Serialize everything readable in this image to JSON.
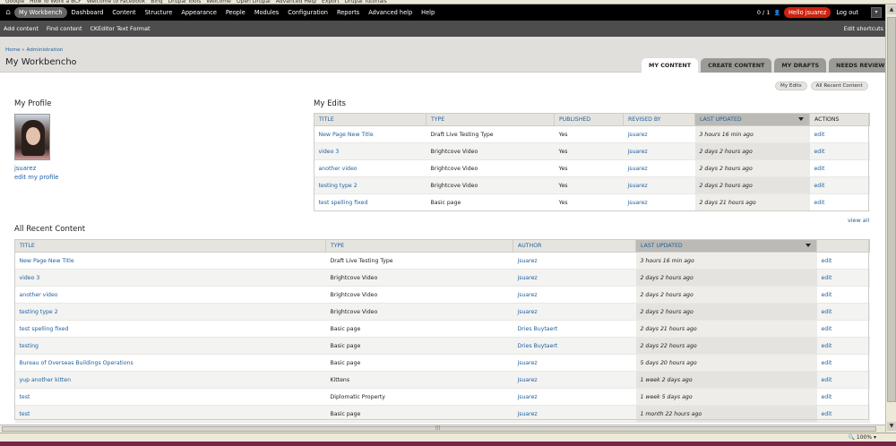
{
  "bookmarks": [
    "Google",
    "How To Work a BCF",
    "Welcome to Facebook",
    "Bing",
    "Drupal Tools",
    "Welcome",
    "Open Drupal",
    "Advanced Help",
    "Export",
    "Drupal Tutorials"
  ],
  "toolbar": {
    "items": [
      "My Workbench",
      "Dashboard",
      "Content",
      "Structure",
      "Appearance",
      "People",
      "Modules",
      "Configuration",
      "Reports",
      "Advanced help",
      "Help"
    ],
    "active_index": 0,
    "count": "0 / 1",
    "hello": "Hello jsuarez",
    "logout": "Log out"
  },
  "shortcuts": {
    "items": [
      "Add content",
      "Find content",
      "CKEditor Text Format"
    ],
    "edit": "Edit shortcuts"
  },
  "header": {
    "breadcrumb": "Home » Administration",
    "title": "My Workbench"
  },
  "tabs": [
    "My Content",
    "Create Content",
    "My Drafts",
    "Needs Review"
  ],
  "tabs_active": 0,
  "subbuttons": [
    "My Edits",
    "All Recent Content"
  ],
  "profile": {
    "heading": "My Profile",
    "username": "jsuarez",
    "edit_link": "edit my profile"
  },
  "my_edits": {
    "heading": "My Edits",
    "columns": [
      "Title",
      "Type",
      "Published",
      "Revised by",
      "Last updated",
      "Actions"
    ],
    "rows": [
      [
        "New Page New Title",
        "Draft Live Testing Type",
        "Yes",
        "jsuarez",
        "3 hours 16 min ago",
        "edit"
      ],
      [
        "video 3",
        "Brightcove Video",
        "Yes",
        "jsuarez",
        "2 days 2 hours ago",
        "edit"
      ],
      [
        "another video",
        "Brightcove Video",
        "Yes",
        "jsuarez",
        "2 days 2 hours ago",
        "edit"
      ],
      [
        "testing type 2",
        "Brightcove Video",
        "Yes",
        "jsuarez",
        "2 days 2 hours ago",
        "edit"
      ],
      [
        "test spelling fixed",
        "Basic page",
        "Yes",
        "jsuarez",
        "2 days 21 hours ago",
        "edit"
      ]
    ],
    "view_all": "view all"
  },
  "recent": {
    "heading": "All Recent Content",
    "columns": [
      "Title",
      "Type",
      "Author",
      "Last updated",
      ""
    ],
    "rows": [
      [
        "New Page New Title",
        "Draft Live Testing Type",
        "jsuarez",
        "3 hours 16 min ago",
        "edit"
      ],
      [
        "video 3",
        "Brightcove Video",
        "jsuarez",
        "2 days 2 hours ago",
        "edit"
      ],
      [
        "another video",
        "Brightcove Video",
        "jsuarez",
        "2 days 2 hours ago",
        "edit"
      ],
      [
        "testing type 2",
        "Brightcove Video",
        "jsuarez",
        "2 days 2 hours ago",
        "edit"
      ],
      [
        "test spelling fixed",
        "Basic page",
        "Dries Buytaert",
        "2 days 21 hours ago",
        "edit"
      ],
      [
        "testing",
        "Basic page",
        "Dries Buytaert",
        "2 days 22 hours ago",
        "edit"
      ],
      [
        "Bureau of Overseas Buildings Operations",
        "Basic page",
        "jsuarez",
        "5 days 20 hours ago",
        "edit"
      ],
      [
        "yup another kitten",
        "Kittens",
        "jsuarez",
        "1 week 2 days ago",
        "edit"
      ],
      [
        "test",
        "Diplomatic Property",
        "jsuarez",
        "1 week 5 days ago",
        "edit"
      ],
      [
        "test",
        "Basic page",
        "jsuarez",
        "1 month 22 hours ago",
        "edit"
      ]
    ]
  },
  "status": {
    "zoom": "100%"
  },
  "colors": {
    "toolbar": "#000000",
    "hello_badge": "#cc2211",
    "link": "#1f5f9e",
    "header_band": "#e0dfdc"
  }
}
